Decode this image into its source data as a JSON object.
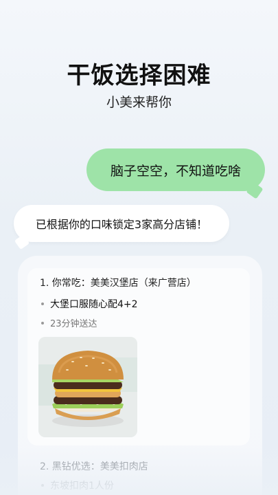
{
  "hero": {
    "title": "干饭选择困难",
    "subtitle": "小美来帮你"
  },
  "chat": {
    "user_message": "脑子空空，不知道吃啥",
    "bot_message": "已根据你的口味锁定3家高分店铺！"
  },
  "card": {
    "shops": [
      {
        "title": "1. 你常吃：美美汉堡店（来广营店）",
        "items": [
          "大堡口服随心配4+2",
          "23分钟送达"
        ],
        "image_icon": "burger-image"
      },
      {
        "title": "2. 黑钻优选：美美扣肉店",
        "items": [
          "东坡扣肉1人份"
        ]
      }
    ]
  },
  "colors": {
    "user_bubble": "#9ee3a8",
    "bot_bubble": "#ffffff",
    "background": "#eaf0f6"
  }
}
